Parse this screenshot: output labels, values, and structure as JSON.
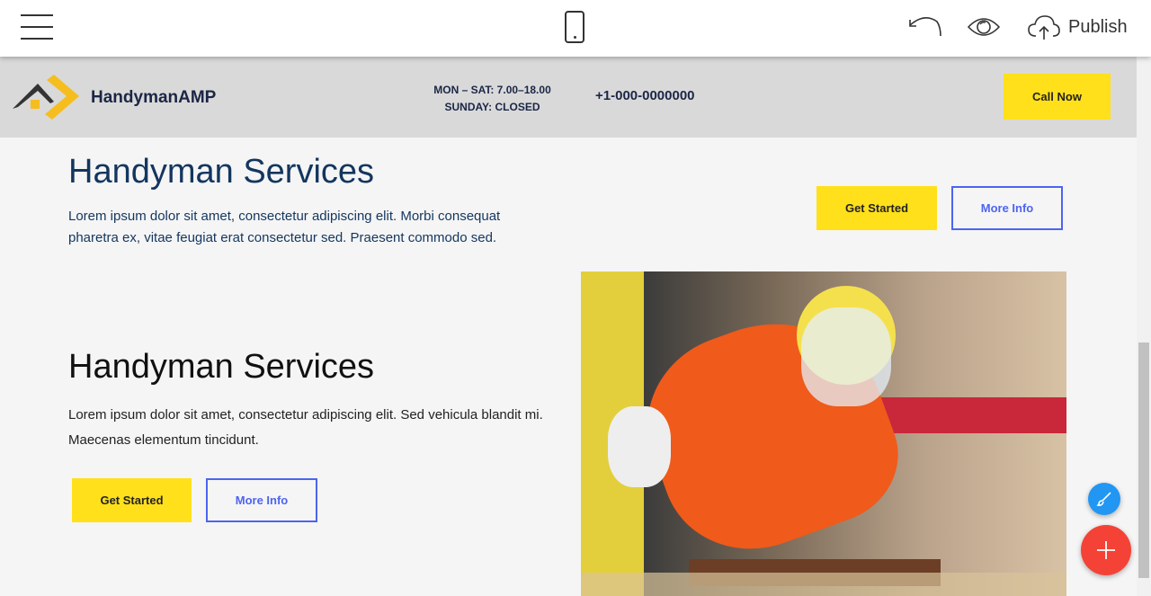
{
  "toolbar": {
    "publish_label": "Publish",
    "icons": [
      "menu-icon",
      "mobile-icon",
      "undo-icon",
      "eye-icon",
      "cloud-upload-icon"
    ]
  },
  "header": {
    "brand": "HandymanAMP",
    "hours_line1": "MON – SAT: 7.00–18.00",
    "hours_line2": "SUNDAY: CLOSED",
    "phone": "+1-000-0000000",
    "cta": "Call Now"
  },
  "section1": {
    "title": "Handyman Services",
    "text": "Lorem ipsum dolor sit amet, consectetur adipiscing elit. Morbi consequat pharetra ex, vitae feugiat erat consectetur sed. Praesent commodo sed.",
    "primary": "Get Started",
    "secondary": "More Info"
  },
  "section2": {
    "title": "Handyman Services",
    "text": "Lorem ipsum dolor sit amet, consectetur adipiscing elit. Sed vehicula blandit mi. Maecenas elementum tincidunt.",
    "primary": "Get Started",
    "secondary": "More Info"
  },
  "colors": {
    "accent": "#ffe01b",
    "outline": "#4d64f0",
    "title": "#13365f",
    "fab_add": "#f44336",
    "fab_edit": "#2196f3"
  }
}
